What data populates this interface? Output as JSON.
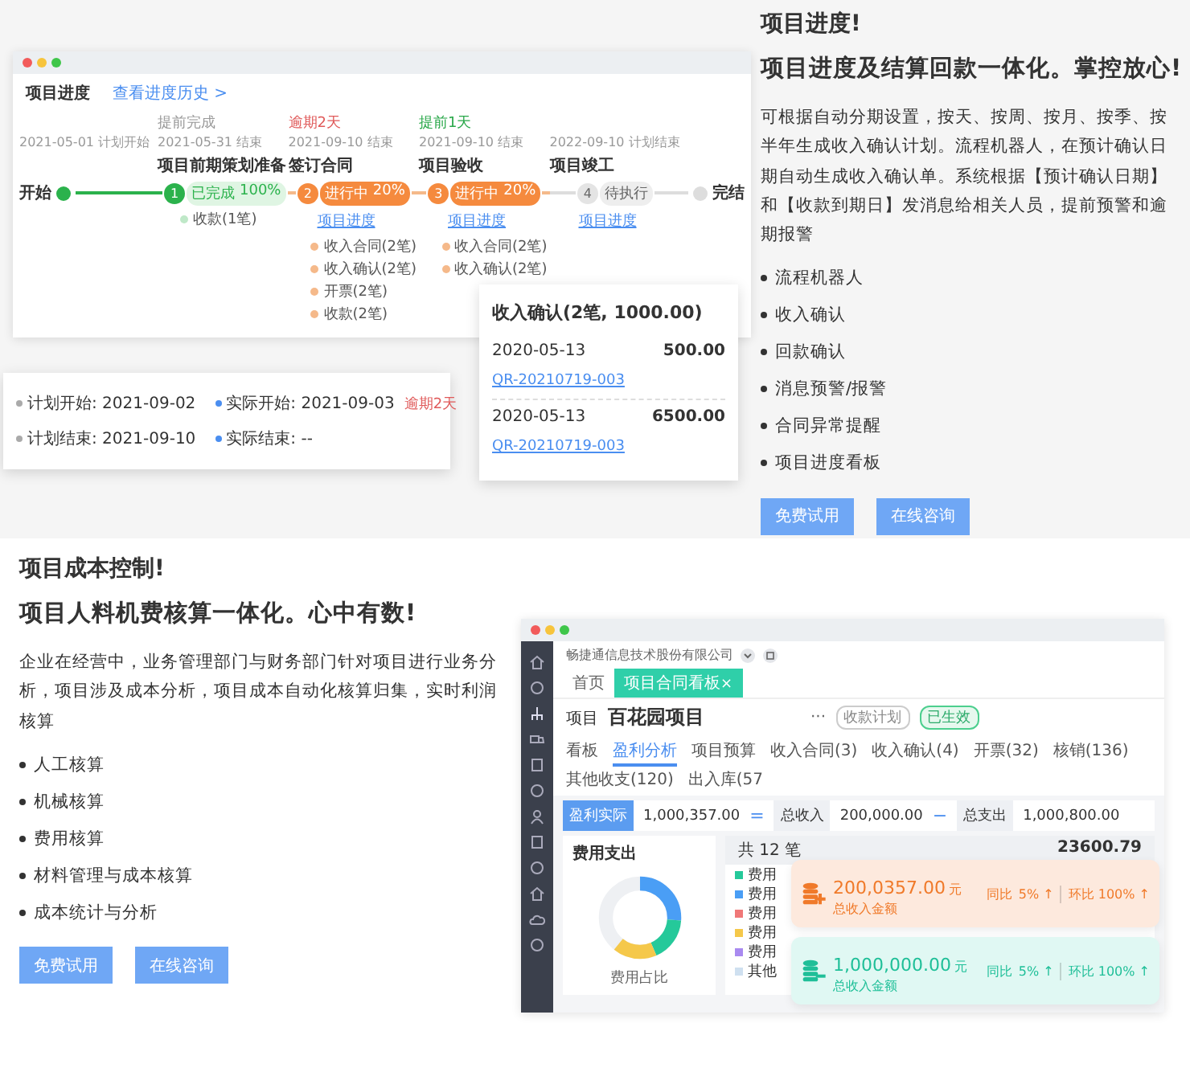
{
  "progress_section": {
    "title": "项目进度!",
    "subtitle": "项目进度及结算回款一体化。掌控放心!",
    "description": "可根据自动分期设置，按天、按周、按月、按季、按半年生成收入确认计划。流程机器人，在预计确认日期自动生成收入确认单。系统根据【预计确认日期】和【收款到期日】发消息给相关人员，提前预警和逾期报警",
    "bullets": [
      "流程机器人",
      "收入确认",
      "回款确认",
      "消息预警/报警",
      "合同异常提醒",
      "项目进度看板"
    ],
    "buttons": [
      "免费试用",
      "在线咨询"
    ]
  },
  "progress_window": {
    "header": "项目进度",
    "history_link": "查看进度历史 >",
    "start": {
      "date": "2021-05-01 计划开始",
      "label": "开始"
    },
    "steps": [
      {
        "number": "1",
        "kind": "done",
        "note": {
          "text": "提前完成",
          "color": "#999999"
        },
        "date": "2021-05-31 结束",
        "title": "项目前期策划准备",
        "status": "已完成",
        "percent": "100%",
        "records": [
          "收款(1笔)"
        ]
      },
      {
        "number": "2",
        "kind": "active",
        "note": {
          "text": "逾期2天",
          "color": "#e05a5a"
        },
        "date": "2021-09-10 结束",
        "title": "签订合同",
        "status": "进行中",
        "percent": "20%",
        "link": "项目进度",
        "records": [
          "收入合同(2笔)",
          "收入确认(2笔)",
          "开票(2笔)",
          "收款(2笔)"
        ]
      },
      {
        "number": "3",
        "kind": "active",
        "note": {
          "text": "提前1天",
          "color": "#2aa84a"
        },
        "date": "2021-09-10 结束",
        "title": "项目验收",
        "status": "进行中",
        "percent": "20%",
        "link": "项目进度",
        "records": [
          "收入合同(2笔)",
          "收入确认(2笔)"
        ]
      },
      {
        "number": "4",
        "kind": "pending",
        "date": "2022-09-10 计划结束",
        "title": "项目竣工",
        "status": "待执行",
        "link": "项目进度"
      }
    ],
    "end_label": "完结"
  },
  "plan_popup": {
    "rows": [
      {
        "kind": "plan",
        "text": "计划开始: 2021-09-02"
      },
      {
        "kind": "actual",
        "text": "实际开始: 2021-09-03",
        "badge": "逾期2天"
      },
      {
        "kind": "plan",
        "text": "计划结束: 2021-09-10"
      },
      {
        "kind": "actual",
        "text": "实际结束: --"
      }
    ]
  },
  "receipt_popup": {
    "title": "收入确认(2笔, 1000.00)",
    "entries": [
      {
        "date": "2020-05-13",
        "amount": "500.00",
        "code": "QR-20210719-003"
      },
      {
        "date": "2020-05-13",
        "amount": "6500.00",
        "code": "QR-20210719-003"
      }
    ]
  },
  "cost_section": {
    "title": "项目成本控制!",
    "subtitle": "项目人料机费核算一体化。心中有数!",
    "description": "企业在经营中，业务管理部门与财务部门针对项目进行业务分析，项目涉及成本分析，项目成本自动化核算归集，实时利润核算",
    "bullets": [
      "人工核算",
      "机械核算",
      "费用核算",
      "材料管理与成本核算",
      "成本统计与分析"
    ],
    "buttons": [
      "免费试用",
      "在线咨询"
    ]
  },
  "cost_window": {
    "company": "畅捷通信息技术股份有限公司",
    "tabs": [
      {
        "label": "首页",
        "selected": false
      },
      {
        "label": "项目合同看板",
        "close": "×",
        "selected": true
      }
    ],
    "project_label": "项目",
    "project_name": "百花园项目",
    "more": "···",
    "plan_tag": "收款计划",
    "status_tag": "已生效",
    "subtabs": [
      {
        "label": "看板",
        "selected": false
      },
      {
        "label": "盈利分析",
        "selected": true
      },
      {
        "label": "项目预算",
        "selected": false
      },
      {
        "label": "收入合同(3)",
        "selected": false
      },
      {
        "label": "收入确认(4)",
        "selected": false
      },
      {
        "label": "开票(32)",
        "selected": false
      },
      {
        "label": "核销(136)",
        "selected": false
      },
      {
        "label": "其他收支(120)",
        "selected": false
      },
      {
        "label": "出入库(57",
        "selected": false
      }
    ],
    "summary": {
      "label": "盈利实际",
      "profit": "1,000,357.00",
      "equals": "=",
      "income_label": "总收入",
      "income": "200,000.00",
      "minus": "−",
      "expense_label": "总支出",
      "expense": "1,000,800.00"
    },
    "expense": {
      "title": "费用支出",
      "count": "共 12 笔",
      "total": "23600.79",
      "donut_caption": "费用占比",
      "legend": [
        {
          "label": "费用",
          "color": "#25c99a"
        },
        {
          "label": "费用",
          "color": "#4a9ef5"
        },
        {
          "label": "费用",
          "color": "#f07878"
        },
        {
          "label": "费用",
          "color": "#f5c84a"
        },
        {
          "label": "费用",
          "color": "#a98af0"
        },
        {
          "label": "其他",
          "color": "#cfe0f0"
        }
      ]
    },
    "cards": [
      {
        "kind": "income",
        "amount": "200,0357.00",
        "unit": "元",
        "caption": "总收入金额",
        "yoy_label": "同比",
        "yoy": "5% ↑",
        "mom": "环比 100% ↑"
      },
      {
        "kind": "expense",
        "amount": "1,000,000.00",
        "unit": "元",
        "caption": "总收入金额",
        "yoy_label": "同比",
        "yoy": "5% ↑",
        "mom": "环比 100% ↑"
      }
    ]
  }
}
